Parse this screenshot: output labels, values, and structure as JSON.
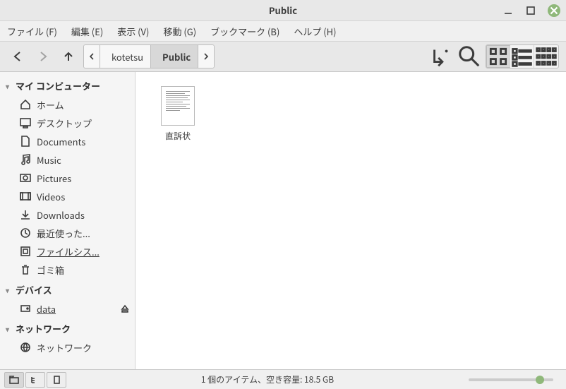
{
  "window": {
    "title": "Public"
  },
  "menu": {
    "file": "ファイル (F)",
    "edit": "編集 (E)",
    "view": "表示 (V)",
    "go": "移動 (G)",
    "bookmarks": "ブックマーク (B)",
    "help": "ヘルプ (H)"
  },
  "path": {
    "segments": [
      {
        "label": "kotetsu",
        "icon": "home"
      },
      {
        "label": "Public",
        "icon": "share",
        "active": true
      }
    ]
  },
  "sidebar": {
    "sections": [
      {
        "title": "マイ コンピューター",
        "items": [
          {
            "label": "ホーム",
            "icon": "home"
          },
          {
            "label": "デスクトップ",
            "icon": "desktop"
          },
          {
            "label": "Documents",
            "icon": "document"
          },
          {
            "label": "Music",
            "icon": "music"
          },
          {
            "label": "Pictures",
            "icon": "pictures"
          },
          {
            "label": "Videos",
            "icon": "videos"
          },
          {
            "label": "Downloads",
            "icon": "downloads"
          },
          {
            "label": "最近使った...",
            "icon": "recent"
          },
          {
            "label": "ファイルシス...",
            "icon": "filesystem",
            "active": true
          },
          {
            "label": "ゴミ箱",
            "icon": "trash"
          }
        ]
      },
      {
        "title": "デバイス",
        "items": [
          {
            "label": "data",
            "icon": "drive",
            "eject": true,
            "underline": true
          }
        ]
      },
      {
        "title": "ネットワーク",
        "items": [
          {
            "label": "ネットワーク",
            "icon": "network"
          }
        ]
      }
    ]
  },
  "files": [
    {
      "name": "直訴状",
      "type": "text"
    }
  ],
  "status": {
    "text": "1 個のアイテム、空き容量: 18.5 GB"
  }
}
